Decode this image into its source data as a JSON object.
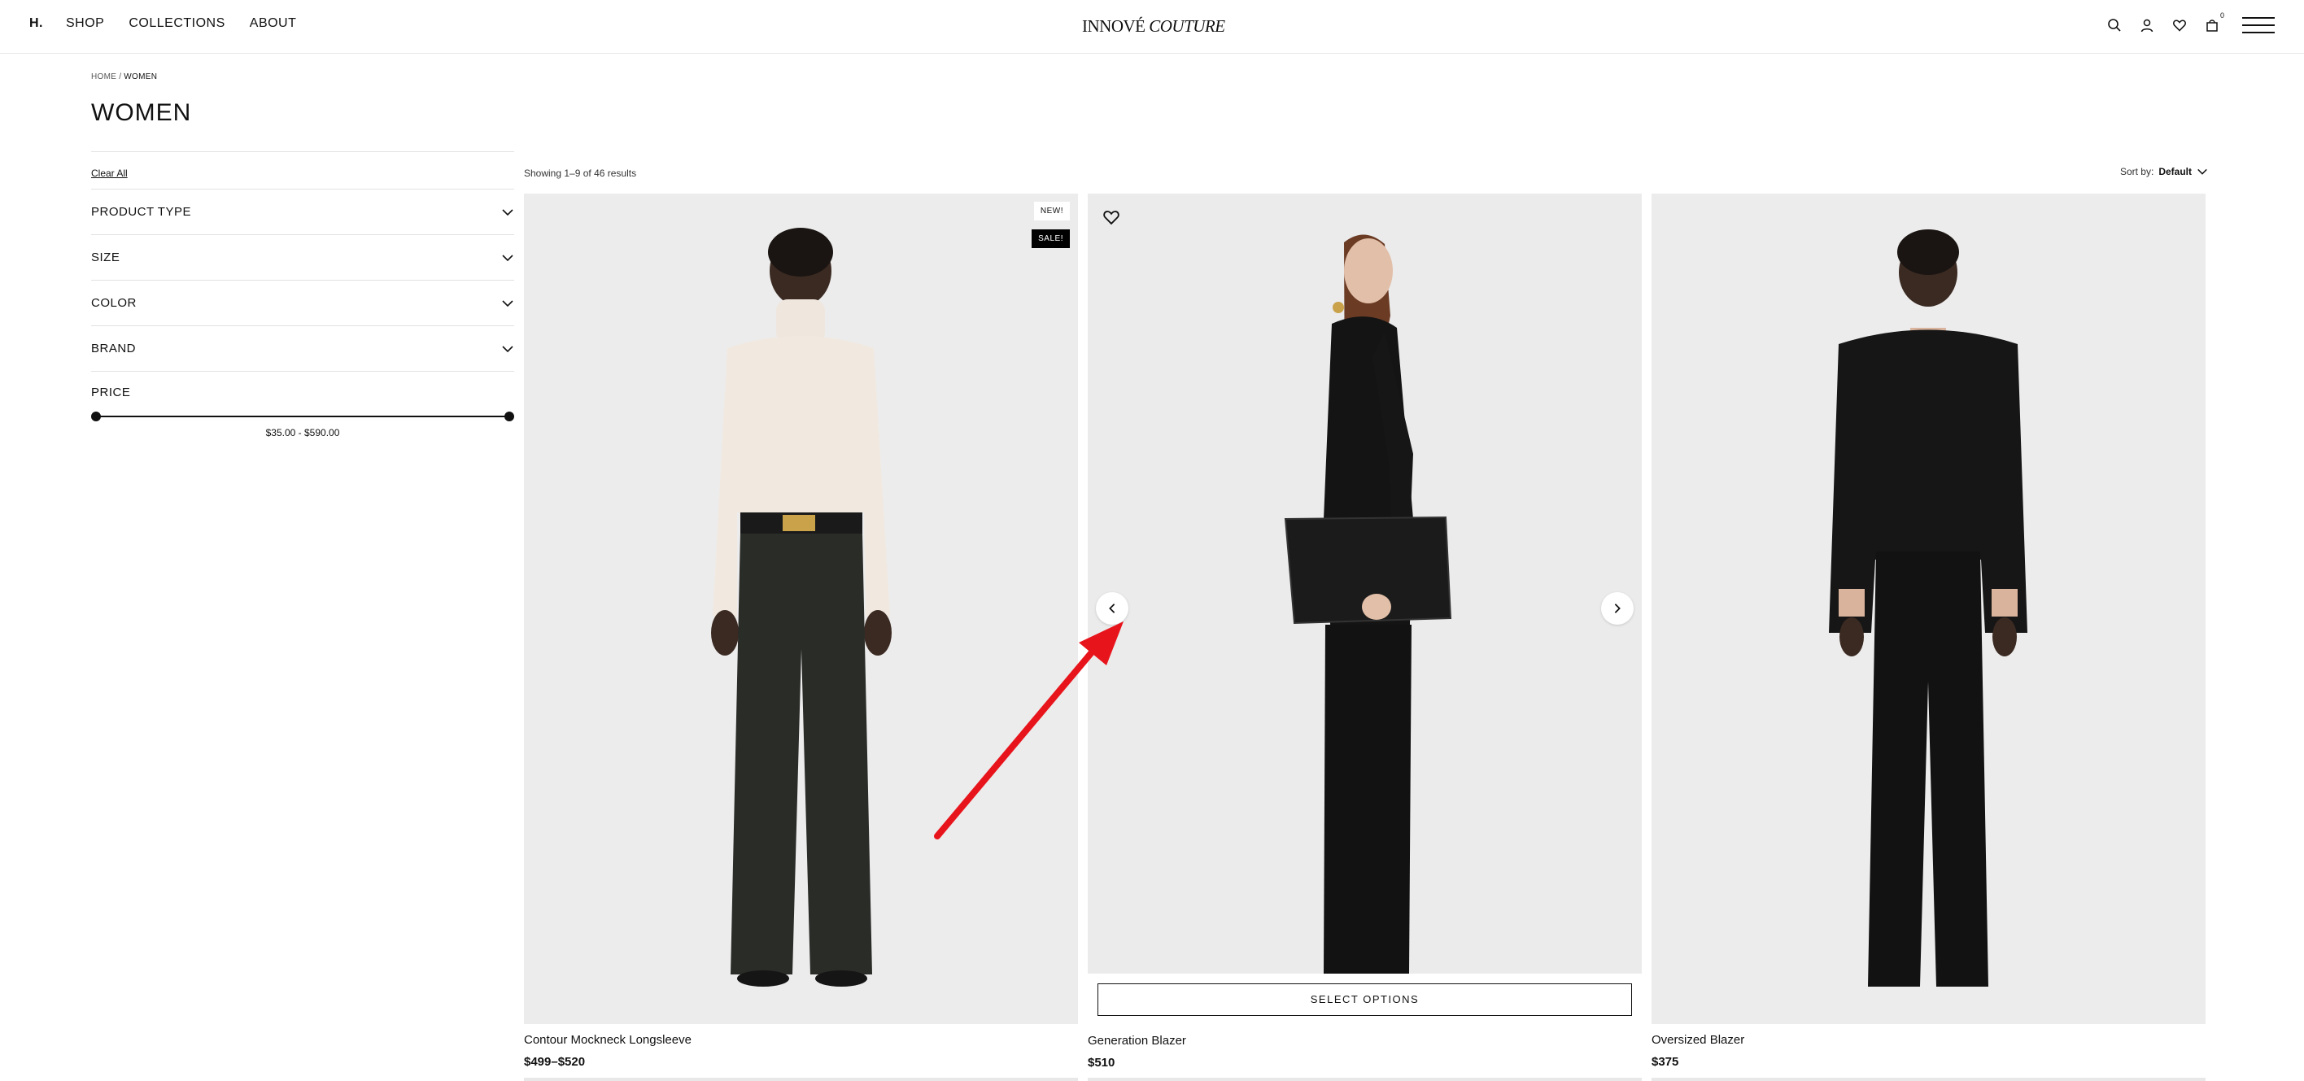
{
  "header": {
    "nav": [
      {
        "label": "H."
      },
      {
        "label": "SHOP"
      },
      {
        "label": "COLLECTIONS"
      },
      {
        "label": "ABOUT"
      }
    ],
    "brand_part1": "INNOVÉ",
    "brand_part2": "COUTURE",
    "cart_count": "0",
    "icons": [
      "search-icon",
      "account-icon",
      "wishlist-icon",
      "cart-icon",
      "menu-icon"
    ]
  },
  "breadcrumb": {
    "home": "HOME",
    "separator": "/",
    "current": "WOMEN"
  },
  "page": {
    "title": "WOMEN"
  },
  "filters": {
    "clear_all": "Clear All",
    "items": [
      {
        "label": "PRODUCT TYPE"
      },
      {
        "label": "SIZE"
      },
      {
        "label": "COLOR"
      },
      {
        "label": "BRAND"
      }
    ],
    "price": {
      "label": "PRICE",
      "range_text": "$35.00 - $590.00",
      "min_fraction": 0,
      "max_fraction": 1
    }
  },
  "results": {
    "count_text": "Showing 1–9 of 46 results",
    "sort_label": "Sort by:",
    "sort_value": "Default"
  },
  "products": [
    {
      "name": "Contour Mockneck Longsleeve",
      "price": "$499–$520",
      "badge_new": "NEW!",
      "badge_sale": "SALE!"
    },
    {
      "name": "Generation Blazer",
      "price": "$510",
      "select_options": "SELECT OPTIONS"
    },
    {
      "name": "Oversized Blazer",
      "price": "$375"
    }
  ],
  "colors": {
    "annotation_arrow": "#e8141c",
    "sale_badge_bg": "#000000"
  }
}
